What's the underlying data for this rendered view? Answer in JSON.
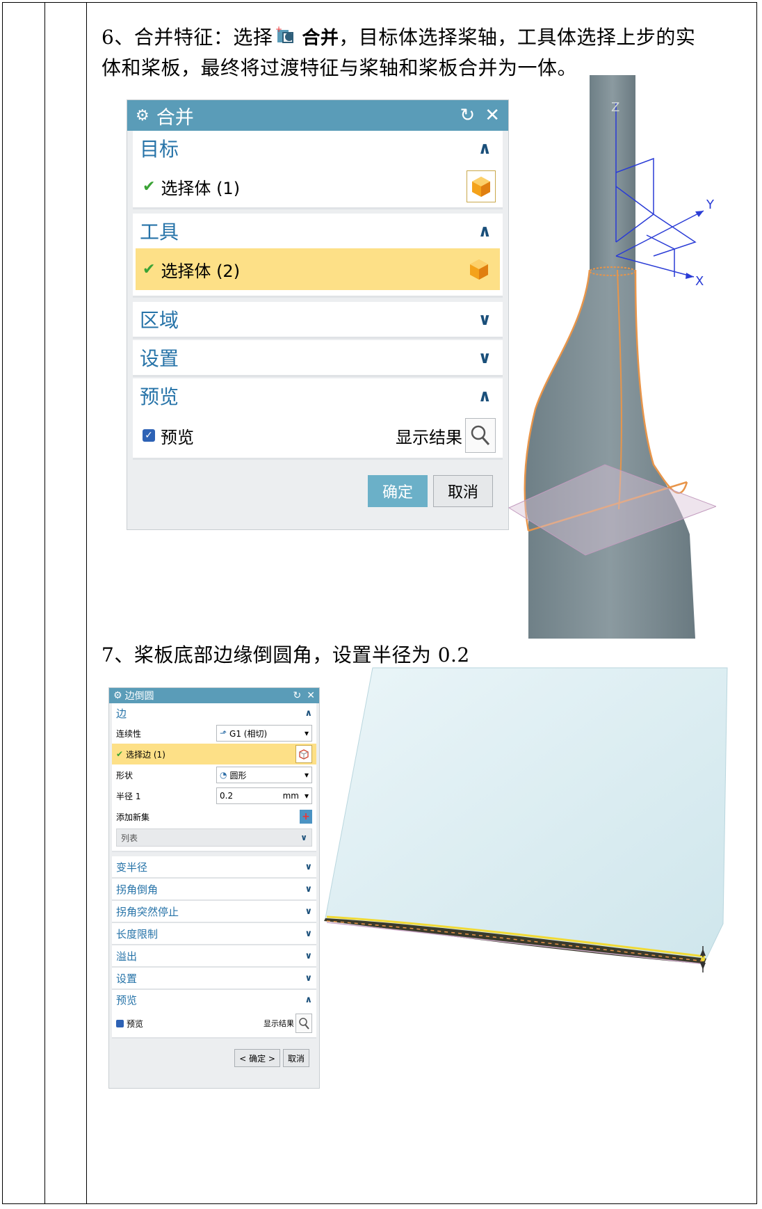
{
  "step6": {
    "text_before": "6、合并特征：选择",
    "icon_label": "合并",
    "text_after_line1": "，目标体选择桨轴，工具体选择上步的实",
    "text_line2": "体和桨板，最终将过渡特征与桨轴和桨板合并为一体。"
  },
  "dialog1": {
    "title": "合并",
    "sections": {
      "target": {
        "label": "目标",
        "row": "选择体 (1)"
      },
      "tool": {
        "label": "工具",
        "row": "选择体 (2)"
      },
      "region": {
        "label": "区域"
      },
      "settings": {
        "label": "设置"
      },
      "preview": {
        "label": "预览",
        "checkbox": "预览",
        "show_result": "显示结果"
      }
    },
    "ok": "确定",
    "cancel": "取消"
  },
  "model1": {
    "axis_z": "Z",
    "axis_y": "Y",
    "axis_x": "X"
  },
  "step7": {
    "text": "7、桨板底部边缘倒圆角，设置半径为 0.2"
  },
  "dialog2": {
    "title": "边倒圆",
    "edge": {
      "label": "边",
      "continuity_label": "连续性",
      "continuity_value": "G1 (相切)",
      "select_edge": "选择边 (1)",
      "shape_label": "形状",
      "shape_value": "圆形",
      "radius_label": "半径 1",
      "radius_value": "0.2",
      "radius_unit": "mm",
      "add_set": "添加新集",
      "list": "列表"
    },
    "collapsed": [
      "变半径",
      "拐角倒角",
      "拐角突然停止",
      "长度限制",
      "溢出",
      "设置"
    ],
    "preview": {
      "label": "预览",
      "checkbox": "预览",
      "show_result": "显示结果"
    },
    "ok": "< 确定 >",
    "cancel": "取消"
  },
  "colors": {
    "titlebar": "#5a9cb8",
    "section_text": "#2673a8",
    "selected_row": "#fde087",
    "ok_button": "#6bb0c8",
    "body_gray": "#7a8a91",
    "edge_orange": "#e8954a",
    "axis_blue": "#2a3cd6"
  }
}
